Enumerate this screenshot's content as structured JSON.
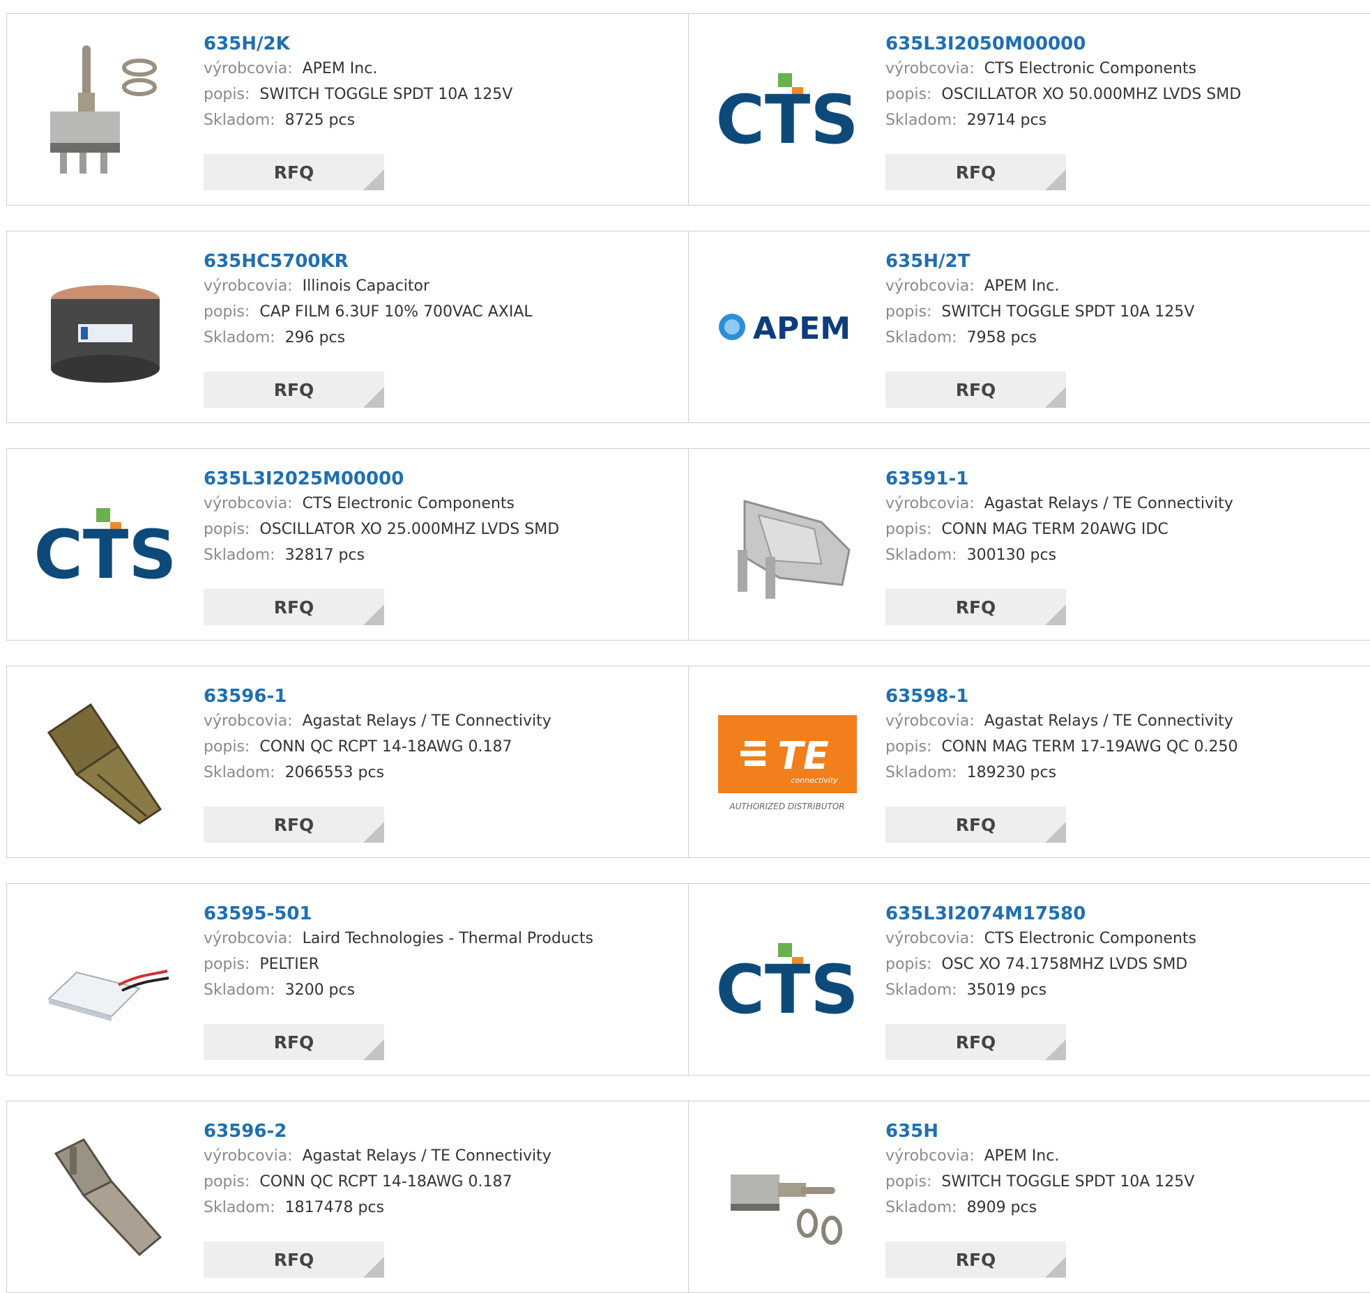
{
  "labels": {
    "manufacturer": "výrobcovia:",
    "description": "popis:",
    "stock": "Skladom:",
    "rfq": "RFQ"
  },
  "colors": {
    "part_link": "#1f6fb2",
    "label_gray": "#8a8a8a",
    "cts_blue": "#0d4a7a",
    "cts_green": "#6ab04c",
    "cts_orange": "#f08a24",
    "apem_blue": "#0d3d7a",
    "te_orange": "#f07f1c"
  },
  "products": [
    {
      "part": "635H/2K",
      "manufacturer": "APEM Inc.",
      "description": "SWITCH TOGGLE SPDT 10A 125V",
      "stock": "8725 pcs",
      "image": "toggle-switch-photo"
    },
    {
      "part": "635L3I2050M00000",
      "manufacturer": "CTS Electronic Components",
      "description": "OSCILLATOR XO 50.000MHZ LVDS SMD",
      "stock": "29714 pcs",
      "image": "cts-logo",
      "logo_text": "CTS"
    },
    {
      "part": "635HC5700KR",
      "manufacturer": "Illinois Capacitor",
      "description": "CAP FILM 6.3UF 10% 700VAC AXIAL",
      "stock": "296 pcs",
      "image": "film-capacitor-photo"
    },
    {
      "part": "635H/2T",
      "manufacturer": "APEM Inc.",
      "description": "SWITCH TOGGLE SPDT 10A 125V",
      "stock": "7958 pcs",
      "image": "apem-logo",
      "logo_text": "APEM"
    },
    {
      "part": "635L3I2025M00000",
      "manufacturer": "CTS Electronic Components",
      "description": "OSCILLATOR XO 25.000MHZ LVDS SMD",
      "stock": "32817 pcs",
      "image": "cts-logo",
      "logo_text": "CTS"
    },
    {
      "part": "63591-1",
      "manufacturer": "Agastat Relays / TE Connectivity",
      "description": "CONN MAG TERM 20AWG IDC",
      "stock": "300130 pcs",
      "image": "idc-terminal-photo"
    },
    {
      "part": "63596-1",
      "manufacturer": "Agastat Relays / TE Connectivity",
      "description": "CONN QC RCPT 14-18AWG 0.187",
      "stock": "2066553 pcs",
      "image": "quick-connect-photo"
    },
    {
      "part": "63598-1",
      "manufacturer": "Agastat Relays / TE Connectivity",
      "description": "CONN MAG TERM 17-19AWG QC 0.250",
      "stock": "189230 pcs",
      "image": "te-logo",
      "logo_text": "TE",
      "logo_subtext": "connectivity",
      "logo_caption": "AUTHORIZED DISTRIBUTOR"
    },
    {
      "part": "63595-501",
      "manufacturer": "Laird Technologies - Thermal Products",
      "description": "PELTIER",
      "stock": "3200 pcs",
      "image": "peltier-module-photo"
    },
    {
      "part": "635L3I2074M17580",
      "manufacturer": "CTS Electronic Components",
      "description": "OSC XO 74.1758MHZ LVDS SMD",
      "stock": "35019 pcs",
      "image": "cts-logo",
      "logo_text": "CTS"
    },
    {
      "part": "63596-2",
      "manufacturer": "Agastat Relays / TE Connectivity",
      "description": "CONN QC RCPT 14-18AWG 0.187",
      "stock": "1817478 pcs",
      "image": "crimp-terminal-photo"
    },
    {
      "part": "635H",
      "manufacturer": "APEM Inc.",
      "description": "SWITCH TOGGLE SPDT 10A 125V",
      "stock": "8909 pcs",
      "image": "toggle-switch-side-photo"
    }
  ]
}
